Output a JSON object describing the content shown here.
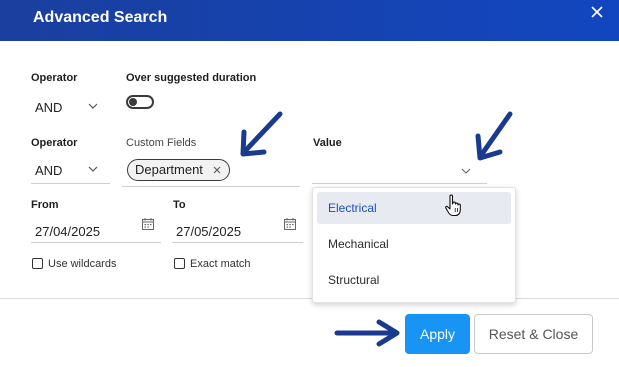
{
  "dialog": {
    "title": "Advanced Search",
    "header_color": "#1a45b4",
    "close_icon": "close-icon"
  },
  "row1": {
    "operator_label": "Operator",
    "operator_value": "AND",
    "duration_label": "Over suggested duration",
    "duration_toggle_on": false
  },
  "row2": {
    "operator_label": "Operator",
    "operator_value": "AND",
    "custom_fields_label": "Custom Fields",
    "custom_field_chip": "Department",
    "value_label": "Value",
    "value_current": ""
  },
  "row3": {
    "from_label": "From",
    "from_value": "27/04/2025",
    "to_label": "To",
    "to_value": "27/05/2025",
    "wildcards_label": "Use wildcards",
    "wildcards_checked": false,
    "exact_label": "Exact match",
    "exact_checked": false
  },
  "dropdown": {
    "options": [
      "Electrical",
      "Mechanical",
      "Structural"
    ],
    "highlighted": "Electrical"
  },
  "footer": {
    "apply_label": "Apply",
    "reset_label": "Reset & Close",
    "apply_color": "#1794f4"
  },
  "annotations": {
    "arrow_color": "#1a3a8f"
  }
}
